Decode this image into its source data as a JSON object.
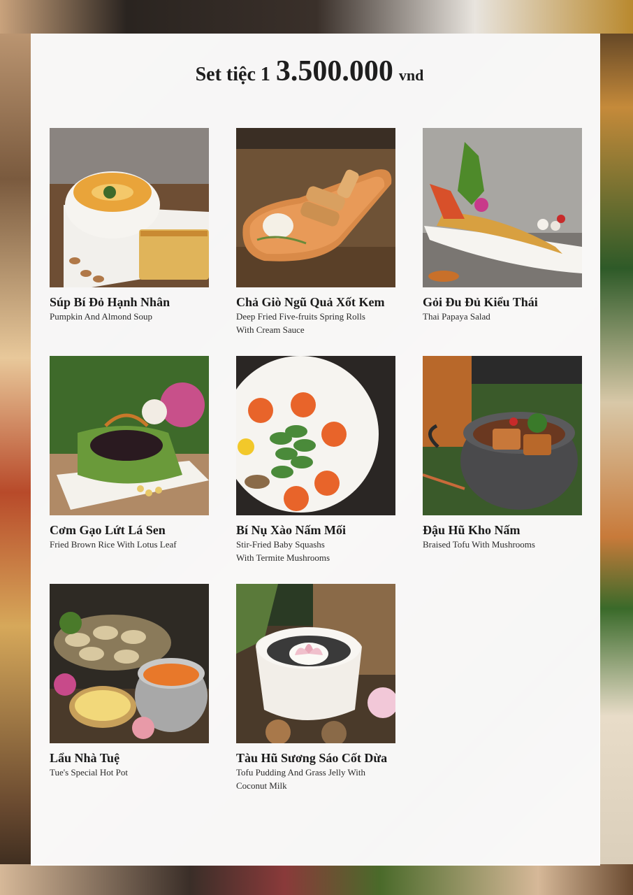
{
  "menu": {
    "title_prefix": "Set tiệc 1",
    "price": "3.500.000",
    "currency": "vnd"
  },
  "dishes": [
    {
      "name": "Súp Bí Đỏ Hạnh Nhân",
      "desc1": "Pumpkin And Almond Soup",
      "desc2": ""
    },
    {
      "name": "Chả Giò Ngũ Quả Xốt Kem",
      "desc1": "Deep Fried Five-fruits Spring Rolls",
      "desc2": "With Cream Sauce"
    },
    {
      "name": "Gỏi Đu Đủ Kiểu Thái",
      "desc1": "Thai Papaya Salad",
      "desc2": ""
    },
    {
      "name": "Cơm Gạo Lứt Lá Sen",
      "desc1": "Fried Brown Rice With Lotus Leaf",
      "desc2": ""
    },
    {
      "name": "Bí Nụ Xào Nấm Mối",
      "desc1": "Stir-Fried Baby Squashs",
      "desc2": "With Termite Mushrooms"
    },
    {
      "name": "Đậu Hũ Kho Nấm",
      "desc1": "Braised Tofu With Mushrooms",
      "desc2": ""
    },
    {
      "name": "Lẩu Nhà Tuệ",
      "desc1": "Tue's Special Hot Pot",
      "desc2": ""
    },
    {
      "name": "Tàu Hũ Sương Sáo Cốt Dừa",
      "desc1": "Tofu Pudding And Grass Jelly With",
      "desc2": "Coconut Milk"
    }
  ]
}
